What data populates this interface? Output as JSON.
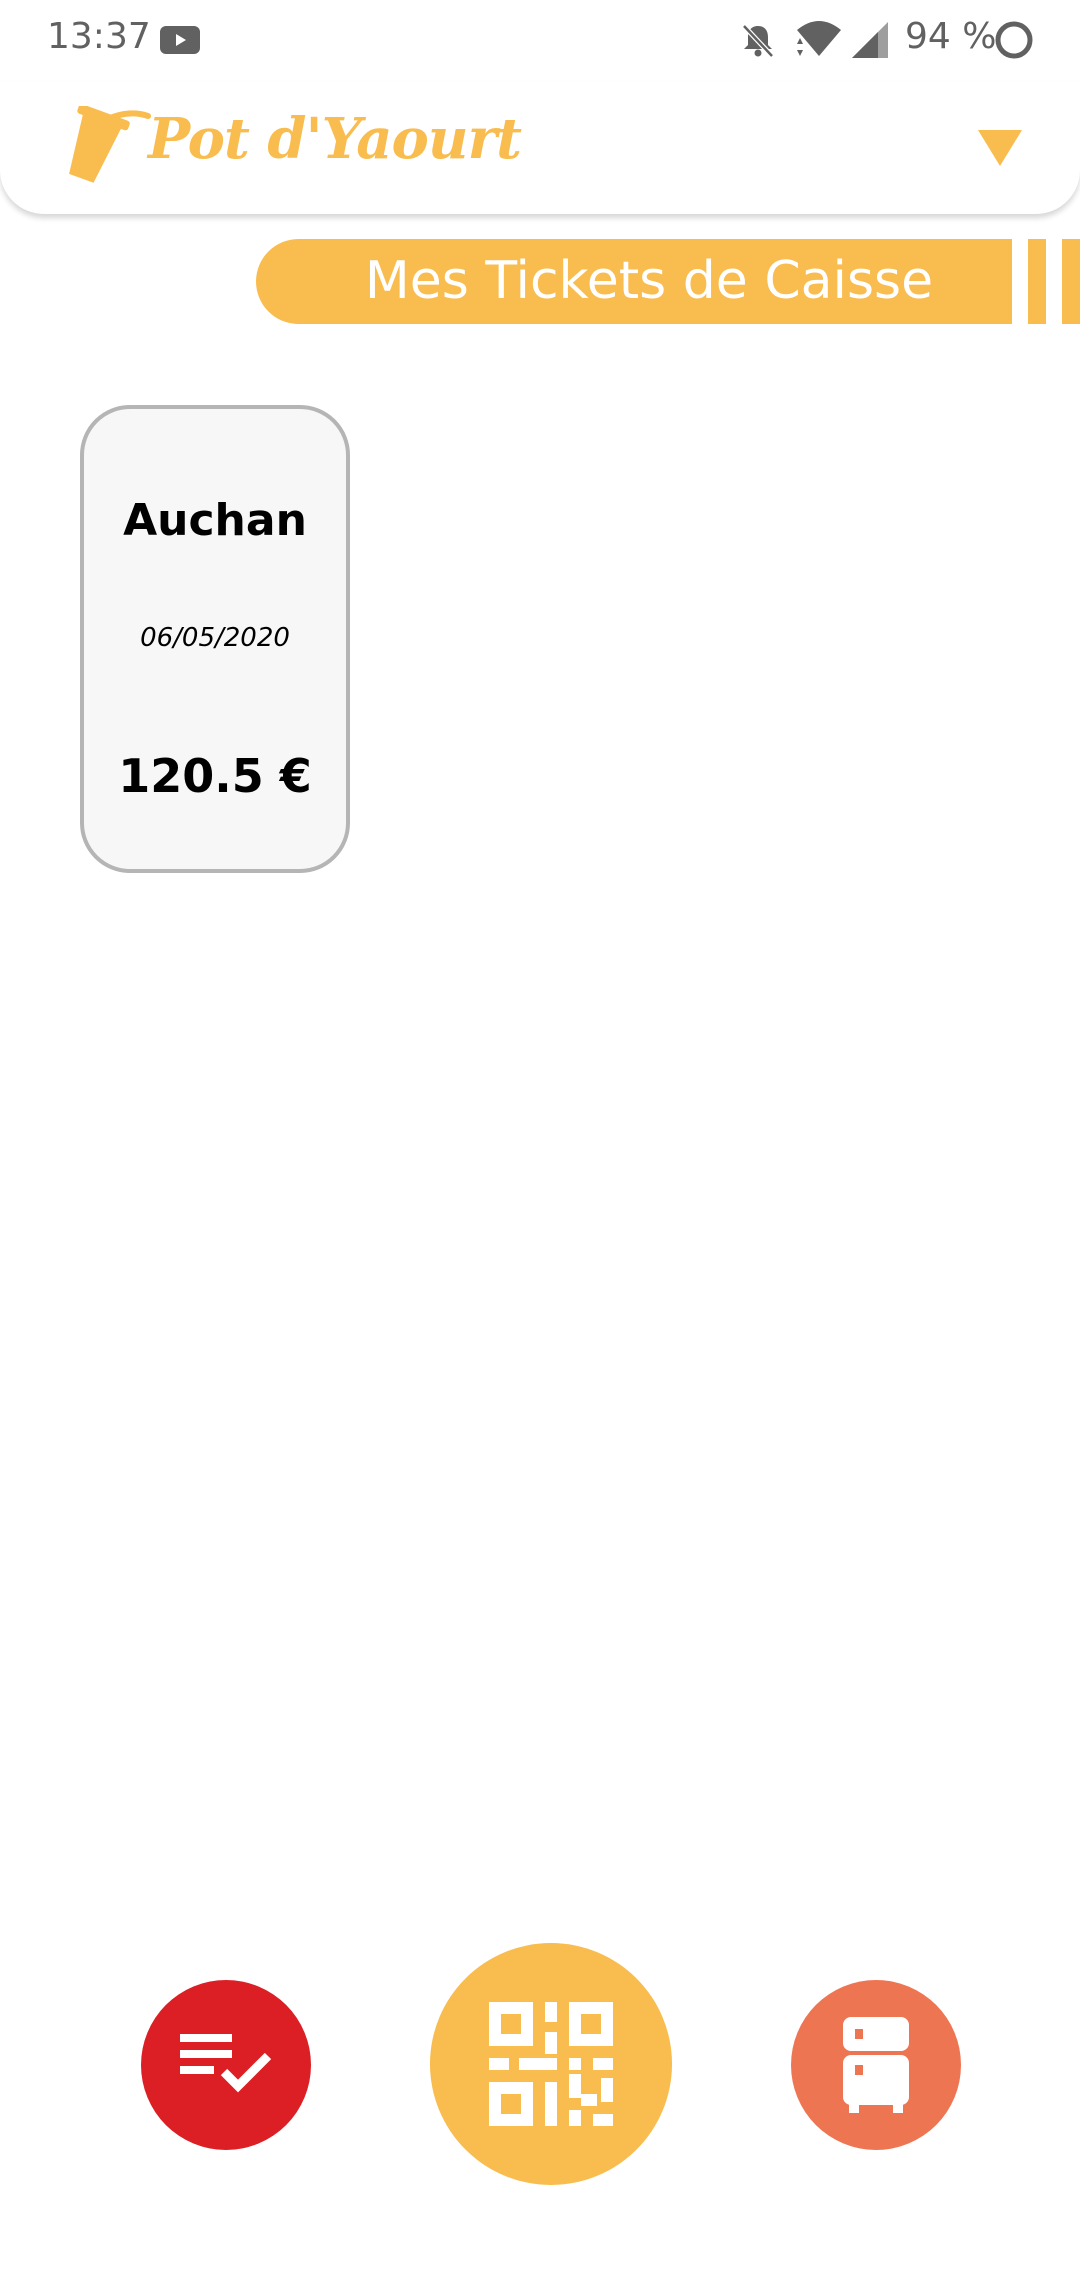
{
  "status_bar": {
    "time": "13:37",
    "battery": "94 %",
    "icons": [
      "youtube-icon",
      "bell-off-icon",
      "wifi-icon",
      "signal-icon",
      "battery-ring-icon"
    ]
  },
  "header": {
    "app_title": "Pot d'Yaourt",
    "logo_icon": "yogurt-cup-icon",
    "menu_icon": "triangle-down-icon"
  },
  "section": {
    "title": "Mes Tickets de Caisse"
  },
  "tickets": [
    {
      "store": "Auchan",
      "date": "06/05/2020",
      "amount": "120.5 €"
    }
  ],
  "bottom_nav": {
    "items": [
      {
        "icon": "checklist-icon",
        "color": "#DB1F24"
      },
      {
        "icon": "qr-code-icon",
        "color": "#F9BC4E"
      },
      {
        "icon": "fridge-icon",
        "color": "#EE7552"
      }
    ]
  },
  "colors": {
    "accent": "#F9BC4E",
    "red": "#DB1F24",
    "orange": "#EE7552",
    "card_border": "#B5B5B5",
    "card_bg": "#F7F7F7"
  }
}
